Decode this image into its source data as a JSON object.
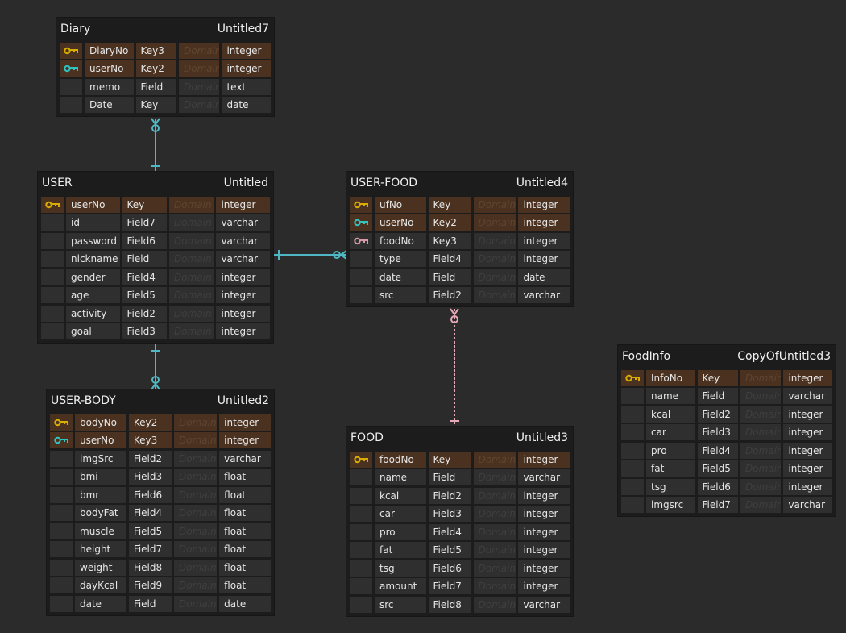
{
  "relationships": [
    {
      "from": "Diary",
      "to": "USER",
      "color": "#4fb8c4",
      "style": "solid"
    },
    {
      "from": "USER-FOOD",
      "to": "USER",
      "color": "#4fb8c4",
      "style": "solid"
    },
    {
      "from": "USER-BODY",
      "to": "USER",
      "color": "#4fb8c4",
      "style": "solid"
    },
    {
      "from": "USER-FOOD",
      "to": "FOOD",
      "color": "#e6a9b8",
      "style": "dashed"
    }
  ],
  "key_colors": {
    "primary": "#d9ad00",
    "foreign": "#2fc4c0",
    "foreign2": "#d99aa8"
  },
  "domain_placeholder": "Domain",
  "tables": [
    {
      "name": "Diary",
      "alias": "Untitled7",
      "columns": [
        {
          "name": "DiaryNo",
          "kind": "Key3",
          "type": "integer",
          "key": "primary"
        },
        {
          "name": "userNo",
          "kind": "Key2",
          "type": "integer",
          "key": "foreign"
        },
        {
          "name": "memo",
          "kind": "Field",
          "type": "text"
        },
        {
          "name": "Date",
          "kind": "Key",
          "type": "date"
        }
      ]
    },
    {
      "name": "USER",
      "alias": "Untitled",
      "columns": [
        {
          "name": "userNo",
          "kind": "Key",
          "type": "integer",
          "key": "primary"
        },
        {
          "name": "id",
          "kind": "Field7",
          "type": "varchar"
        },
        {
          "name": "password",
          "kind": "Field6",
          "type": "varchar"
        },
        {
          "name": "nickname",
          "kind": "Field",
          "type": "varchar"
        },
        {
          "name": "gender",
          "kind": "Field4",
          "type": "integer"
        },
        {
          "name": "age",
          "kind": "Field5",
          "type": "integer"
        },
        {
          "name": "activity",
          "kind": "Field2",
          "type": "integer"
        },
        {
          "name": "goal",
          "kind": "Field3",
          "type": "integer"
        }
      ]
    },
    {
      "name": "USER-FOOD",
      "alias": "Untitled4",
      "columns": [
        {
          "name": "ufNo",
          "kind": "Key",
          "type": "integer",
          "key": "primary"
        },
        {
          "name": "userNo",
          "kind": "Key2",
          "type": "integer",
          "key": "foreign"
        },
        {
          "name": "foodNo",
          "kind": "Key3",
          "type": "integer",
          "key": "foreign2"
        },
        {
          "name": "type",
          "kind": "Field4",
          "type": "integer"
        },
        {
          "name": "date",
          "kind": "Field",
          "type": "date"
        },
        {
          "name": "src",
          "kind": "Field2",
          "type": "varchar"
        }
      ]
    },
    {
      "name": "USER-BODY",
      "alias": "Untitled2",
      "columns": [
        {
          "name": "bodyNo",
          "kind": "Key2",
          "type": "integer",
          "key": "primary"
        },
        {
          "name": "userNo",
          "kind": "Key3",
          "type": "integer",
          "key": "foreign"
        },
        {
          "name": "imgSrc",
          "kind": "Field2",
          "type": "varchar"
        },
        {
          "name": "bmi",
          "kind": "Field3",
          "type": "float"
        },
        {
          "name": "bmr",
          "kind": "Field6",
          "type": "float"
        },
        {
          "name": "bodyFat",
          "kind": "Field4",
          "type": "float"
        },
        {
          "name": "muscle",
          "kind": "Field5",
          "type": "float"
        },
        {
          "name": "height",
          "kind": "Field7",
          "type": "float"
        },
        {
          "name": "weight",
          "kind": "Field8",
          "type": "float"
        },
        {
          "name": "dayKcal",
          "kind": "Field9",
          "type": "float"
        },
        {
          "name": "date",
          "kind": "Field",
          "type": "date"
        }
      ]
    },
    {
      "name": "FOOD",
      "alias": "Untitled3",
      "columns": [
        {
          "name": "foodNo",
          "kind": "Key",
          "type": "integer",
          "key": "primary"
        },
        {
          "name": "name",
          "kind": "Field",
          "type": "varchar"
        },
        {
          "name": "kcal",
          "kind": "Field2",
          "type": "integer"
        },
        {
          "name": "car",
          "kind": "Field3",
          "type": "integer"
        },
        {
          "name": "pro",
          "kind": "Field4",
          "type": "integer"
        },
        {
          "name": "fat",
          "kind": "Field5",
          "type": "integer"
        },
        {
          "name": "tsg",
          "kind": "Field6",
          "type": "integer"
        },
        {
          "name": "amount",
          "kind": "Field7",
          "type": "integer"
        },
        {
          "name": "src",
          "kind": "Field8",
          "type": "varchar"
        }
      ]
    },
    {
      "name": "FoodInfo",
      "alias": "CopyOfUntitled3",
      "columns": [
        {
          "name": "InfoNo",
          "kind": "Key",
          "type": "integer",
          "key": "primary"
        },
        {
          "name": "name",
          "kind": "Field",
          "type": "varchar"
        },
        {
          "name": "kcal",
          "kind": "Field2",
          "type": "integer"
        },
        {
          "name": "car",
          "kind": "Field3",
          "type": "integer"
        },
        {
          "name": "pro",
          "kind": "Field4",
          "type": "integer"
        },
        {
          "name": "fat",
          "kind": "Field5",
          "type": "integer"
        },
        {
          "name": "tsg",
          "kind": "Field6",
          "type": "integer"
        },
        {
          "name": "imgsrc",
          "kind": "Field7",
          "type": "varchar"
        }
      ]
    }
  ]
}
